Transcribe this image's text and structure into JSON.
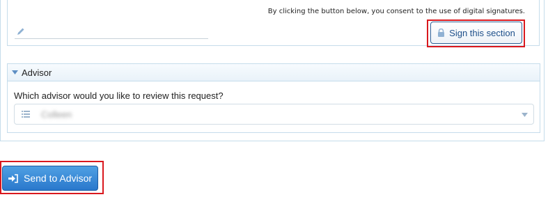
{
  "signature": {
    "consent_text": "By clicking the button below, you consent to the use of digital signatures.",
    "sign_button_label": "Sign this section"
  },
  "advisor": {
    "section_title": "Advisor",
    "question": "Which advisor would you like to review this request?",
    "selected_value": "Colleen"
  },
  "actions": {
    "send_button_label": "Send to Advisor"
  },
  "colors": {
    "highlight": "#d9181e",
    "primary_button": "#2a78cc",
    "border": "#c5dceb"
  }
}
